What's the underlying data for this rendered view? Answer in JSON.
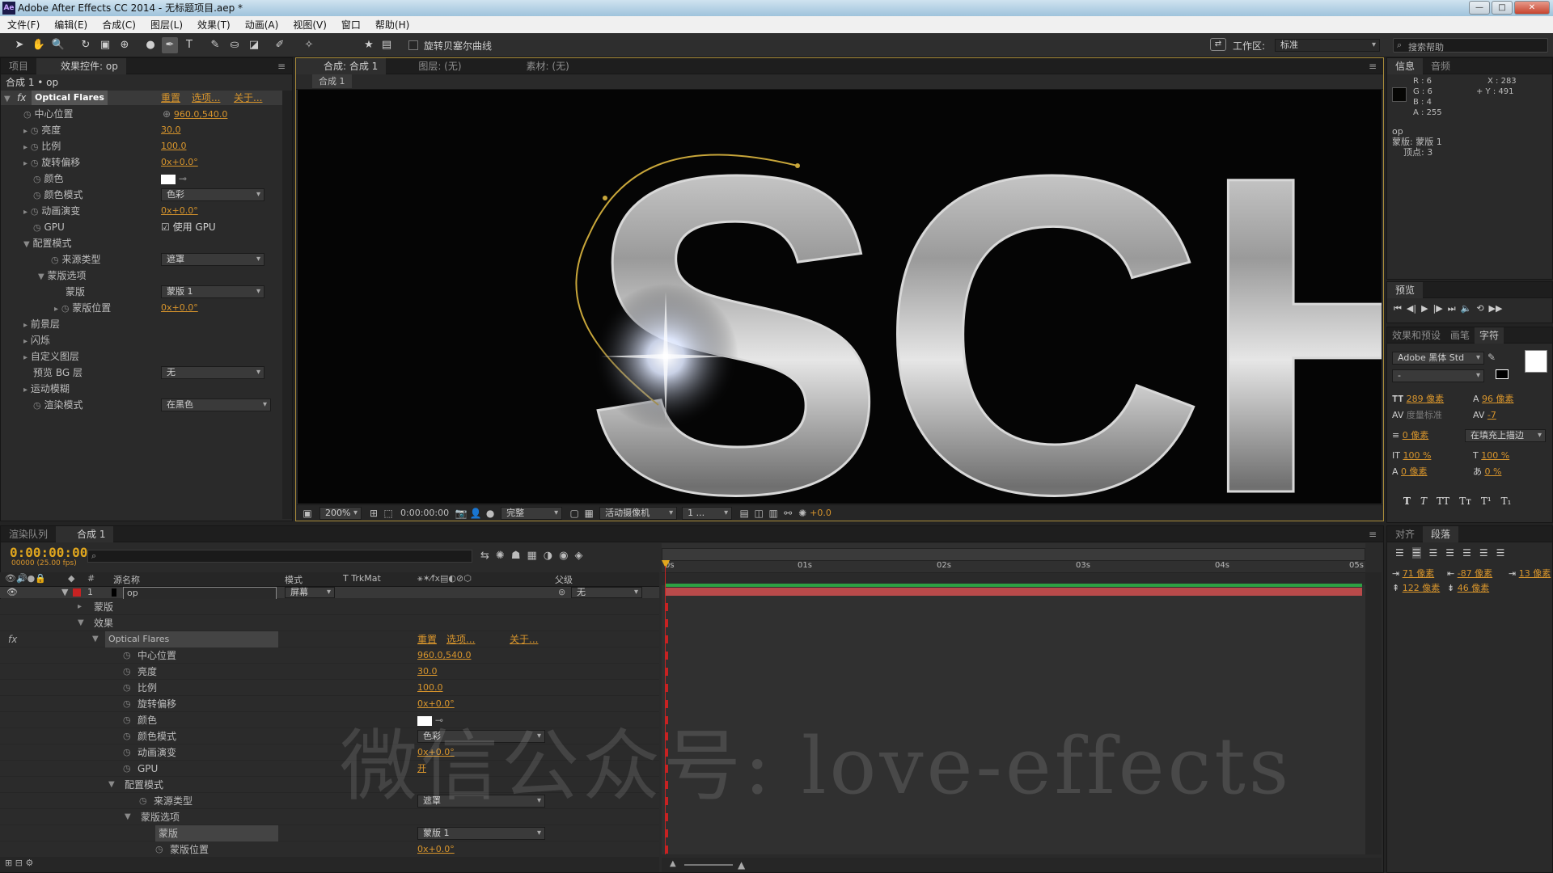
{
  "window": {
    "title": "Adobe After Effects CC 2014 - 无标题项目.aep *",
    "app_icon": "Ae",
    "min": "—",
    "max": "□",
    "close": "✕"
  },
  "menu": [
    "文件(F)",
    "编辑(E)",
    "合成(C)",
    "图层(L)",
    "效果(T)",
    "动画(A)",
    "视图(V)",
    "窗口",
    "帮助(H)"
  ],
  "toolbar": {
    "rotobezier_label": "旋转贝塞尔曲线",
    "workspace_label": "工作区:",
    "workspace_value": "标准",
    "search_placeholder": "搜索帮助"
  },
  "effect_panel": {
    "tabs": [
      "项目",
      "效果控件: op"
    ],
    "header": "合成 1 • op",
    "effect_name": "Optical Flares",
    "reset": "重置",
    "options": "选项...",
    "about": "关于...",
    "props": [
      {
        "label": "中心位置",
        "value": "960.0,540.0"
      },
      {
        "label": "亮度",
        "value": "30.0"
      },
      {
        "label": "比例",
        "value": "100.0"
      },
      {
        "label": "旋转偏移",
        "value": "0x+0.0°"
      },
      {
        "label": "颜色",
        "value": ""
      },
      {
        "label": "颜色模式",
        "value": "色彩"
      },
      {
        "label": "动画演变",
        "value": "0x+0.0°"
      },
      {
        "label": "GPU",
        "value": "使用 GPU"
      },
      {
        "label": "配置模式",
        "value": ""
      },
      {
        "label": "来源类型",
        "value": "遮罩"
      },
      {
        "label": "蒙版选项",
        "value": ""
      },
      {
        "label": "蒙版",
        "value": "蒙版 1"
      },
      {
        "label": "蒙版位置",
        "value": "0x+0.0°"
      },
      {
        "label": "前景层",
        "value": ""
      },
      {
        "label": "闪烁",
        "value": ""
      },
      {
        "label": "自定义图层",
        "value": ""
      },
      {
        "label": "预览 BG 层",
        "value": "无"
      },
      {
        "label": "运动模糊",
        "value": ""
      },
      {
        "label": "渲染模式",
        "value": "在黑色"
      }
    ]
  },
  "comp_panel": {
    "tabs": [
      "合成: 合成 1",
      "图层: (无)",
      "素材: (无)"
    ],
    "sub_tab": "合成 1",
    "status": {
      "zoom": "200%",
      "time": "0:00:00:00",
      "quality": "完整",
      "camera": "活动摄像机",
      "views": "1 ...",
      "exposure": "+0.0"
    },
    "content_text": "SCHO"
  },
  "info_panel": {
    "tabs": [
      "信息",
      "音频"
    ],
    "r": "R : 6",
    "g": "G : 6",
    "b": "B : 4",
    "a": "A : 255",
    "x": "X : 283",
    "y": "+ Y : 491",
    "layer": "op",
    "mask": "蒙版: 蒙版 1",
    "vertices": "顶点: 3"
  },
  "preview_panel": {
    "tab": "预览"
  },
  "char_panel": {
    "tabs": [
      "效果和预设",
      "画笔",
      "字符"
    ],
    "font": "Adobe 黑体 Std",
    "style": "-",
    "size": "289 像素",
    "leading": "96 像素",
    "kerning": "度量标准",
    "tracking": "-7",
    "stroke": "0 像素",
    "stroke_type": "在填充上描边",
    "vscale": "100 %",
    "hscale": "100 %",
    "baseline": "0 像素",
    "tsume": "0 %",
    "styles": [
      "T",
      "T",
      "TT",
      "Tт",
      "T¹",
      "T₁"
    ]
  },
  "para_panel": {
    "tabs": [
      "对齐",
      "段落"
    ],
    "indent_l": "71 像素",
    "indent_r": "-87 像素",
    "indent_first": "13 像素",
    "space_before": "122 像素",
    "space_after": "46 像素"
  },
  "timeline": {
    "tabs": [
      "渲染队列",
      "合成 1"
    ],
    "timecode": "0:00:00:00",
    "fps": "00000 (25.00 fps)",
    "search_placeholder": "",
    "cols": {
      "source": "源名称",
      "mode": "模式",
      "trk": "T  TrkMat",
      "parent": "父级"
    },
    "ruler": [
      "0s",
      "01s",
      "02s",
      "03s",
      "04s",
      "05s"
    ],
    "layer": {
      "num": "1",
      "name": "op",
      "mode": "屏幕",
      "parent": "无"
    },
    "rows": [
      {
        "label": "蒙版",
        "value": ""
      },
      {
        "label": "效果",
        "value": ""
      },
      {
        "label": "Optical Flares",
        "value": ""
      },
      {
        "label": "中心位置",
        "value": "960.0,540.0"
      },
      {
        "label": "亮度",
        "value": "30.0"
      },
      {
        "label": "比例",
        "value": "100.0"
      },
      {
        "label": "旋转偏移",
        "value": "0x+0.0°"
      },
      {
        "label": "颜色",
        "value": ""
      },
      {
        "label": "颜色模式",
        "value": "色彩"
      },
      {
        "label": "动画演变",
        "value": "0x+0.0°"
      },
      {
        "label": "GPU",
        "value": "开"
      },
      {
        "label": "配置模式",
        "value": ""
      },
      {
        "label": "来源类型",
        "value": "遮罩"
      },
      {
        "label": "蒙版选项",
        "value": ""
      },
      {
        "label": "蒙版",
        "value": "蒙版 1"
      },
      {
        "label": "蒙版位置",
        "value": "0x+0.0°"
      }
    ],
    "fx_reset": "重置",
    "fx_options": "选项...",
    "fx_about": "关于..."
  },
  "watermark": "微信公众号: love-effects",
  "colors": {
    "accent": "#d8952c",
    "bg": "#232323",
    "panel": "#2a2a2a",
    "keyframe": "#c72222"
  }
}
